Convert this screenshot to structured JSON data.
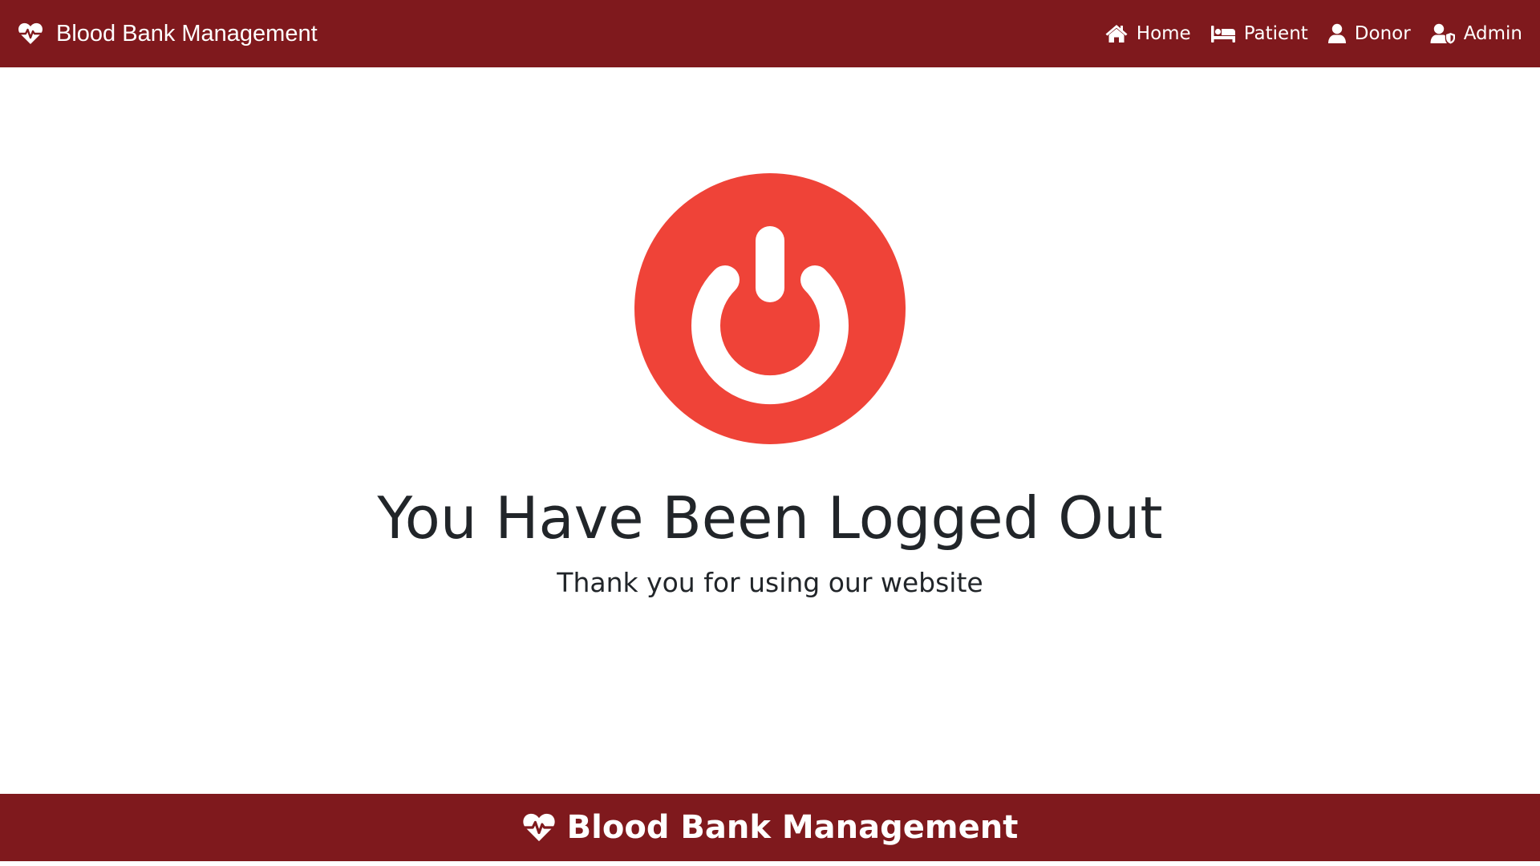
{
  "colors": {
    "navbar_bg": "#7f191d",
    "footer_bg": "#7f191d",
    "power_button": "#ef4338",
    "text_dark": "#212529",
    "text_light": "#ffffff"
  },
  "navbar": {
    "brand": {
      "icon": "heartbeat-icon",
      "title": "Blood Bank Management"
    },
    "links": [
      {
        "icon": "home-icon",
        "label": "Home"
      },
      {
        "icon": "bed-icon",
        "label": "Patient"
      },
      {
        "icon": "user-icon",
        "label": "Donor"
      },
      {
        "icon": "user-shield-icon",
        "label": "Admin"
      }
    ]
  },
  "main": {
    "icon": "power-icon",
    "heading": "You Have Been Logged Out",
    "subheading": "Thank you for using our website"
  },
  "footer": {
    "icon": "heartbeat-icon",
    "title": "Blood Bank Management"
  }
}
